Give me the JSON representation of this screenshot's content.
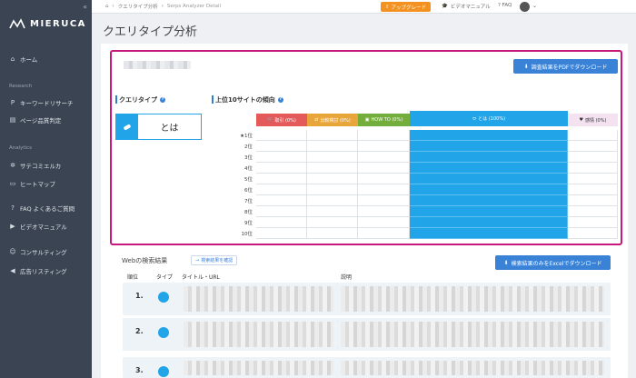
{
  "sidebar": {
    "collapse": "«",
    "logo": "MIERUCA",
    "items": [
      {
        "label": "ホーム",
        "icon": "home-icon"
      },
      {
        "label": "キーワードリサーチ",
        "icon": "keyword-icon"
      },
      {
        "label": "ページ品質判定",
        "icon": "document-icon"
      },
      {
        "label": "サテコミエルカ",
        "icon": "gear-icon"
      },
      {
        "label": "ヒートマップ",
        "icon": "monitor-icon"
      },
      {
        "label": "FAQ よくあるご質問",
        "icon": "question-icon"
      },
      {
        "label": "ビデオマニュアル",
        "icon": "video-icon"
      },
      {
        "label": "コンサルティング",
        "icon": "people-icon"
      },
      {
        "label": "広告リスティング",
        "icon": "megaphone-icon"
      }
    ],
    "sections": [
      "Research",
      "Analytics"
    ]
  },
  "topbar": {
    "breadcrumb": [
      "クエリタイプ分析",
      "Serps Analyzer Detail"
    ],
    "upgrade": "アップグレード",
    "video_manual": "ビデオマニュアル",
    "faq": "FAQ"
  },
  "page": {
    "title": "クエリタイプ分析",
    "pdf_button": "調査結果をPDFでダウンロード",
    "query_type_heading": "クエリタイプ",
    "query_type_value": "とは",
    "trend_heading": "上位10サイトの傾向",
    "columns": [
      {
        "label": "取引 (0%)",
        "color": "#e45a5a",
        "icon": "cart-icon"
      },
      {
        "label": "比較検討 (0%)",
        "color": "#e8a63a",
        "icon": "compare-icon"
      },
      {
        "label": "HOW TO (0%)",
        "color": "#73ad3c",
        "icon": "book-icon"
      },
      {
        "label": "とは (100%)",
        "color": "#21a4e8",
        "icon": "pill-icon"
      },
      {
        "label": "感情 (0%)",
        "color": "#f5e2f1",
        "icon": "heart-icon"
      }
    ],
    "ranks": [
      "1位",
      "2位",
      "3位",
      "4位",
      "5位",
      "6位",
      "7位",
      "8位",
      "9位",
      "10位"
    ],
    "web_results_title": "Webの検索結果",
    "confirm_link": "検索結果を確認",
    "excel_button": "検索結果のみをExcelでダウンロード",
    "table_headers": [
      "順位",
      "タイプ",
      "タイトル・URL",
      "説明"
    ],
    "results": [
      "1.",
      "2.",
      "3."
    ]
  }
}
